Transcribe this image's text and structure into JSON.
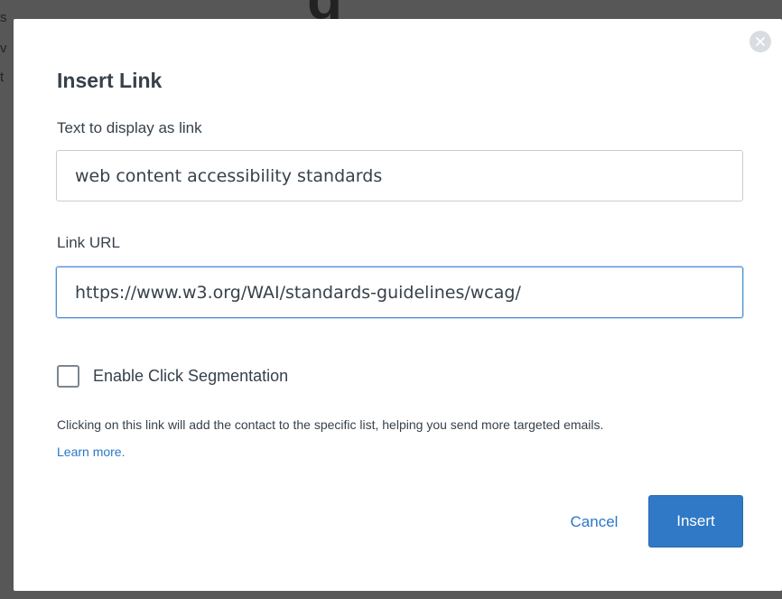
{
  "modal": {
    "title": "Insert Link",
    "display_text": {
      "label": "Text to display as link",
      "value": "web content accessibility standards"
    },
    "url": {
      "label": "Link URL",
      "value": "https://www.w3.org/WAI/standards-guidelines/wcag/"
    },
    "click_segmentation": {
      "label": "Enable Click Segmentation",
      "checked": false
    },
    "help_text": "Clicking on this link will add the contact to the specific list, helping you send more targeted emails.",
    "learn_more": "Learn more.",
    "cancel_label": "Cancel",
    "insert_label": "Insert",
    "icons": {
      "close": "close-icon"
    }
  },
  "colors": {
    "accent": "#2f79c6",
    "link": "#2a77c9",
    "text": "#37414b",
    "focus_border": "#4f8ed4"
  }
}
